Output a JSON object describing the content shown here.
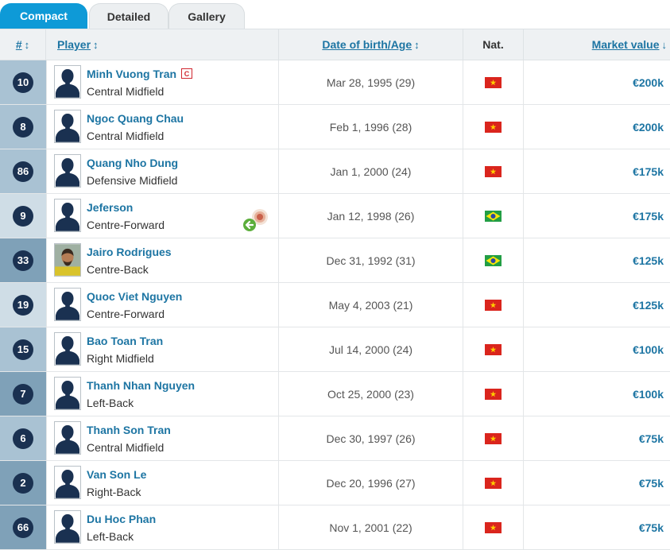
{
  "tabs": [
    {
      "label": "Compact",
      "active": true
    },
    {
      "label": "Detailed",
      "active": false
    },
    {
      "label": "Gallery",
      "active": false
    }
  ],
  "columns": {
    "number": "#",
    "player": "Player",
    "dob": "Date of birth/Age",
    "nat": "Nat.",
    "market_value": "Market value"
  },
  "colors": {
    "accent": "#0e9ad7",
    "link": "#1d75a3",
    "badge": "#1a3151",
    "stripe_light": "#cfdde6",
    "stripe_mid": "#a9c2d3",
    "stripe_dark": "#7fa1b8"
  },
  "players": [
    {
      "number": "10",
      "name": "Minh Vuong Tran",
      "position": "Central Midfield",
      "dob": "Mar 28, 1995 (29)",
      "nat": "vietnam-flag",
      "value": "€200k",
      "captain": "C",
      "photo": "silhouette-icon",
      "stripe": "mid"
    },
    {
      "number": "8",
      "name": "Ngoc Quang Chau",
      "position": "Central Midfield",
      "dob": "Feb 1, 1996 (28)",
      "nat": "vietnam-flag",
      "value": "€200k",
      "photo": "silhouette-icon",
      "stripe": "mid"
    },
    {
      "number": "86",
      "name": "Quang Nho Dung",
      "position": "Defensive Midfield",
      "dob": "Jan 1, 2000 (24)",
      "nat": "vietnam-flag",
      "value": "€175k",
      "photo": "silhouette-icon",
      "stripe": "mid"
    },
    {
      "number": "9",
      "name": "Jeferson",
      "position": "Centre-Forward",
      "dob": "Jan 12, 1998 (26)",
      "nat": "brazil-flag",
      "value": "€175k",
      "photo": "silhouette-icon",
      "joined": "loan-return-icon",
      "stripe": "light"
    },
    {
      "number": "33",
      "name": "Jairo Rodrigues",
      "position": "Centre-Back",
      "dob": "Dec 31, 1992 (31)",
      "nat": "brazil-flag",
      "value": "€125k",
      "photo": "player-photo-icon",
      "stripe": "dark"
    },
    {
      "number": "19",
      "name": "Quoc Viet Nguyen",
      "position": "Centre-Forward",
      "dob": "May 4, 2003 (21)",
      "nat": "vietnam-flag",
      "value": "€125k",
      "photo": "silhouette-icon",
      "stripe": "light"
    },
    {
      "number": "15",
      "name": "Bao Toan Tran",
      "position": "Right Midfield",
      "dob": "Jul 14, 2000 (24)",
      "nat": "vietnam-flag",
      "value": "€100k",
      "photo": "silhouette-icon",
      "stripe": "mid"
    },
    {
      "number": "7",
      "name": "Thanh Nhan Nguyen",
      "position": "Left-Back",
      "dob": "Oct 25, 2000 (23)",
      "nat": "vietnam-flag",
      "value": "€100k",
      "photo": "silhouette-icon",
      "stripe": "dark"
    },
    {
      "number": "6",
      "name": "Thanh Son Tran",
      "position": "Central Midfield",
      "dob": "Dec 30, 1997 (26)",
      "nat": "vietnam-flag",
      "value": "€75k",
      "photo": "silhouette-icon",
      "stripe": "mid"
    },
    {
      "number": "2",
      "name": "Van Son Le",
      "position": "Right-Back",
      "dob": "Dec 20, 1996 (27)",
      "nat": "vietnam-flag",
      "value": "€75k",
      "photo": "silhouette-icon",
      "stripe": "dark"
    },
    {
      "number": "66",
      "name": "Du Hoc Phan",
      "position": "Left-Back",
      "dob": "Nov 1, 2001 (22)",
      "nat": "vietnam-flag",
      "value": "€75k",
      "photo": "silhouette-icon",
      "stripe": "dark"
    }
  ]
}
